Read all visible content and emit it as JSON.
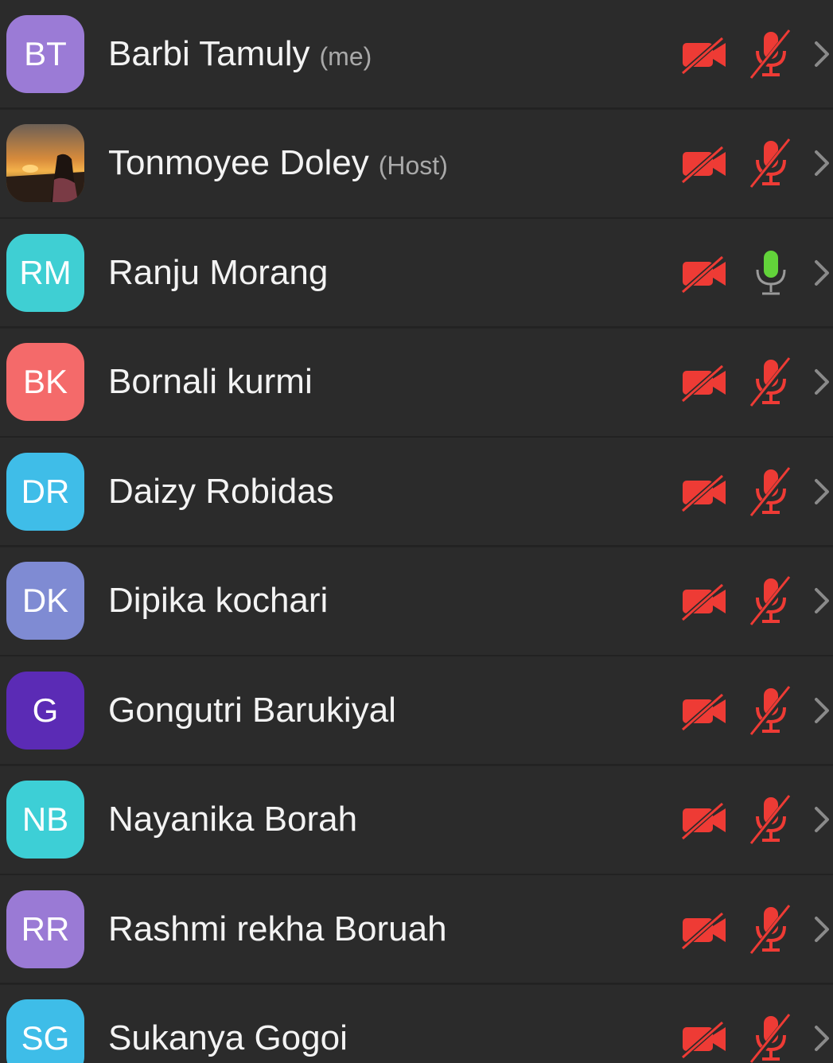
{
  "participants": [
    {
      "initials": "BT",
      "name": "Barbi Tamuly",
      "tag": "(me)",
      "avatar_color": "#9b7bd6",
      "photo": false,
      "mic": "muted"
    },
    {
      "initials": "",
      "name": "Tonmoyee Doley",
      "tag": "(Host)",
      "avatar_color": "#5a4432",
      "photo": true,
      "mic": "muted"
    },
    {
      "initials": "RM",
      "name": "Ranju Morang",
      "tag": "",
      "avatar_color": "#3fcfd3",
      "photo": false,
      "mic": "on"
    },
    {
      "initials": "BK",
      "name": "Bornali kurmi",
      "tag": "",
      "avatar_color": "#f46a6a",
      "photo": false,
      "mic": "muted"
    },
    {
      "initials": "DR",
      "name": "Daizy Robidas",
      "tag": "",
      "avatar_color": "#3fbde8",
      "photo": false,
      "mic": "muted"
    },
    {
      "initials": "DK",
      "name": "Dipika kochari",
      "tag": "",
      "avatar_color": "#7f8bd3",
      "photo": false,
      "mic": "muted"
    },
    {
      "initials": "G",
      "name": "Gongutri Barukiyal",
      "tag": "",
      "avatar_color": "#5b2bb5",
      "photo": false,
      "mic": "muted"
    },
    {
      "initials": "NB",
      "name": "Nayanika Borah",
      "tag": "",
      "avatar_color": "#3dcfd6",
      "photo": false,
      "mic": "muted"
    },
    {
      "initials": "RR",
      "name": "Rashmi rekha Boruah",
      "tag": "",
      "avatar_color": "#9a7ad5",
      "photo": false,
      "mic": "muted"
    },
    {
      "initials": "SG",
      "name": "Sukanya Gogoi",
      "tag": "",
      "avatar_color": "#3ebde8",
      "photo": false,
      "mic": "muted"
    }
  ],
  "icons": {
    "camera": "camera-off-icon",
    "mic_muted": "mic-muted-icon",
    "mic_on": "mic-on-icon",
    "chevron": "chevron-right-icon"
  },
  "colors": {
    "muted_red": "#ee3b35",
    "mic_green": "#62d33a",
    "chevron": "#8a8a8a",
    "row_bg": "#2b2b2b"
  }
}
